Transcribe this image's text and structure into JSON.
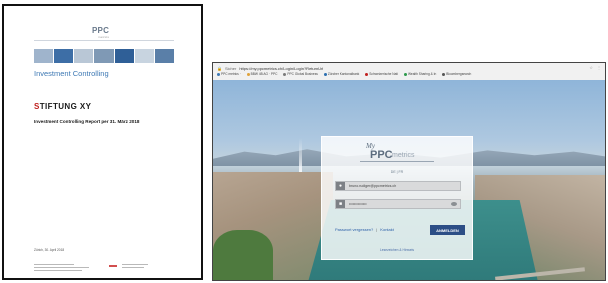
{
  "report": {
    "logo_text": "PPC",
    "logo_sub": "metrics",
    "title": "Investment Controlling",
    "org_mark": "S",
    "org_rest": "TIFTUNG XY",
    "report_title": "Investment Controlling Report per 31. März 2018",
    "date_line": "Zürich, 30. April 2018",
    "colors": {
      "accent": "#3e79b4",
      "mark": "#c0201e"
    },
    "strip_colors": [
      "#9fb4cc",
      "#3d6ea6",
      "#b9c7d6",
      "#7f99b5",
      "#2f5f97",
      "#c8d4e0",
      "#5a7fa8"
    ]
  },
  "browser": {
    "tab_label": "Sicher",
    "url": "https://my.ppcmetrics.ch/Login/Login?ReturnUrl",
    "bookmarks": [
      {
        "label": "PPC metrics ·",
        "color": "#3e79b4"
      },
      {
        "label": "BBW 4B AG · PPC",
        "color": "#e0a23a"
      },
      {
        "label": "PPC Global Business",
        "color": "#7a7a7a"
      },
      {
        "label": "Zürcher Kantonalbank",
        "color": "#2c6fb0"
      },
      {
        "label": "Schweizerische Nati",
        "color": "#c0201e"
      },
      {
        "label": "Wealth Sharing & In",
        "color": "#2c9a4b"
      },
      {
        "label": "Bloombergsearch",
        "color": "#555555"
      }
    ],
    "chrome_icons": [
      "star-icon",
      "menu-icon"
    ]
  },
  "login": {
    "brand_my": "My",
    "brand_ppc": "PPC",
    "brand_metrics": "metrics",
    "language": "DE | FR",
    "email_value": "bruno.rudiger@ppcmetrics.ch",
    "password_value": "••••••••••••••",
    "forgot_link": "Passwort vergessen?",
    "help_link": "Kontakt",
    "login_button": "ANMELDEN",
    "footer_link": "Lesezeichen & Hinweis"
  }
}
